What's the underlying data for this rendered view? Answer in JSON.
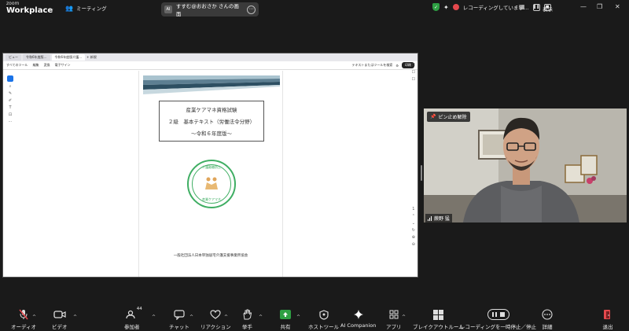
{
  "app": {
    "logo_top": "zoom",
    "logo_bottom": "Workplace",
    "meeting_tab": "ミーティング",
    "share_banner": "すすむ@おおさか さんの画面",
    "share_avatar": "AI",
    "recording_status": "レコーディングしています…",
    "view_label": "表示"
  },
  "shared_screen": {
    "browser_tabs": [
      "ビュー",
      "令和6年度版…",
      "令和6年度版介護…"
    ],
    "new_tab": "+ 新規",
    "toolbar_items": [
      "すべてのツール",
      "編集",
      "変換",
      "電子サイン"
    ],
    "toolbar_right": "テキストまたはツールを検索",
    "print_button": "印刷",
    "document": {
      "title_line1": "産業ケアマネ資格試験",
      "title_line2": "２級　基本テキスト（労働法令分野）",
      "title_line3": "〜令和６年度版〜",
      "seal_top": "介護離職防止",
      "seal_bottom": "産業ケアマネ",
      "publisher": "一般社団法人日本単独居宅介護支援事業所協会"
    }
  },
  "video": {
    "pin_label": "ピン止め解除",
    "participant_name": "蕨野 猛"
  },
  "toolbar": {
    "audio": "オーディオ",
    "video": "ビデオ",
    "participants": "参加者",
    "participants_count": "44",
    "chat": "チャット",
    "reactions": "リアクション",
    "raise_hand": "挙手",
    "share": "共有",
    "host_tools": "ホストツール",
    "ai_companion": "AI Companion",
    "apps": "アプリ",
    "breakout": "ブレイクアウトルーム",
    "recording": "レコーディングを一時停止／停止",
    "more": "詳細",
    "leave": "退出"
  },
  "colors": {
    "accent_green": "#3fae63",
    "share_green": "#2ea043",
    "record_red": "#e5484d",
    "leave_red": "#e5484d"
  }
}
